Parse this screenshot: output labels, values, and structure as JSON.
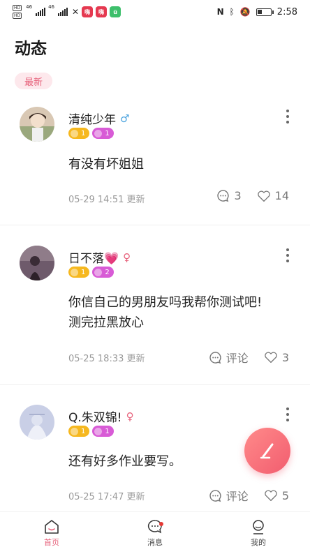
{
  "status_bar": {
    "time": "2:58",
    "network_1": "46",
    "network_2": "46",
    "app_chip_1": "嗨",
    "app_chip_2": "嗨",
    "app_chip_3": "ü"
  },
  "header": {
    "title": "动态"
  },
  "tabs": {
    "active": "最新"
  },
  "posts": [
    {
      "username": "清纯少年",
      "gender_symbol": "♂",
      "badge_1": "1",
      "badge_2": "1",
      "content_line_1": "有没有坏姐姐",
      "content_line_2": "",
      "meta": "05-29 14:51 更新",
      "comments": "3",
      "likes": "14"
    },
    {
      "username": "日不落💗",
      "gender_symbol": "♀",
      "badge_1": "1",
      "badge_2": "2",
      "content_line_1": "你信自己的男朋友吗我帮你测试吧!",
      "content_line_2": "测完拉黑放心",
      "meta": "05-25 18:33 更新",
      "comments": "评论",
      "likes": "3"
    },
    {
      "username": "Q.朱双锦!",
      "gender_symbol": "♀",
      "badge_1": "1",
      "badge_2": "1",
      "content_line_1": "还有好多作业要写。",
      "content_line_2": "",
      "meta": "05-25 17:47 更新",
      "comments": "评论",
      "likes": "5"
    }
  ],
  "bottom_nav": {
    "home": "首页",
    "messages": "消息",
    "mine": "我的"
  },
  "colors": {
    "accent": "#e7647d",
    "male": "#4aa3df",
    "female": "#e7647d",
    "badge_yellow": "#f6b81f",
    "badge_pink": "#d85bd6"
  }
}
